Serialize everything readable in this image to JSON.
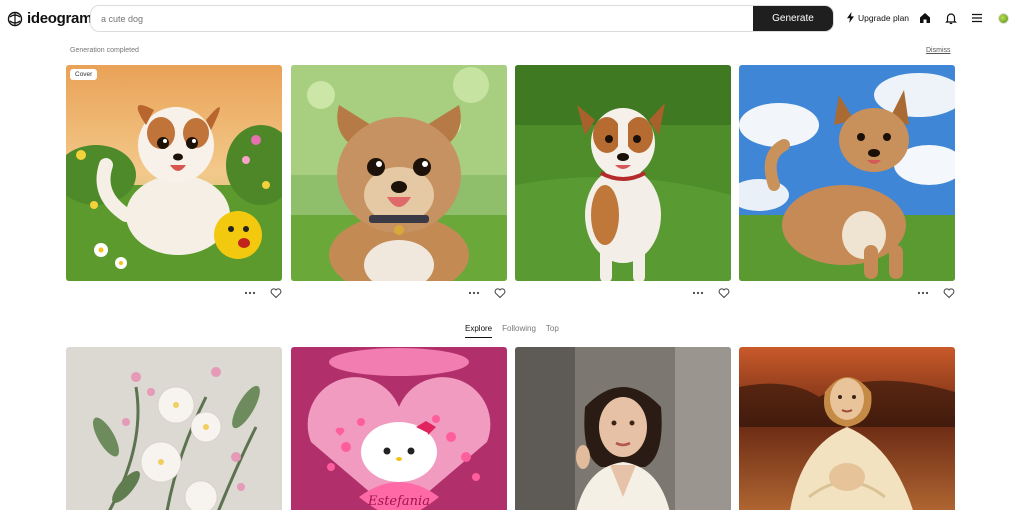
{
  "app": {
    "name": "ideogram"
  },
  "search": {
    "placeholder": "a cute dog",
    "value": ""
  },
  "toolbar": {
    "generate_label": "Generate",
    "upgrade_label": "Upgrade plan"
  },
  "status": {
    "message": "Generation completed",
    "dismiss_label": "Dismiss"
  },
  "generated": {
    "cover_label": "Cover",
    "images": [
      {
        "subject": "cartoon puppy with yellow ball in flower garden at sunset"
      },
      {
        "subject": "fluffy terrier puppy with collar in green park"
      },
      {
        "subject": "jack russell terrier sitting on grass"
      },
      {
        "subject": "terrier dog sitting on grass under blue sky"
      }
    ]
  },
  "tabs": [
    {
      "label": "Explore",
      "active": true
    },
    {
      "label": "Following",
      "active": false
    },
    {
      "label": "Top",
      "active": false
    }
  ],
  "explore": {
    "images": [
      {
        "subject": "pink and white flower bouquet"
      },
      {
        "subject": "hello kitty inside pink heart balloon",
        "text": "Estefania"
      },
      {
        "subject": "woman in white blazer portrait"
      },
      {
        "subject": "girl in white dress painting"
      }
    ]
  },
  "colors": {
    "generate_bg": "#1f1f1f",
    "accent": "#111111",
    "avatar": "#8bc34a"
  }
}
